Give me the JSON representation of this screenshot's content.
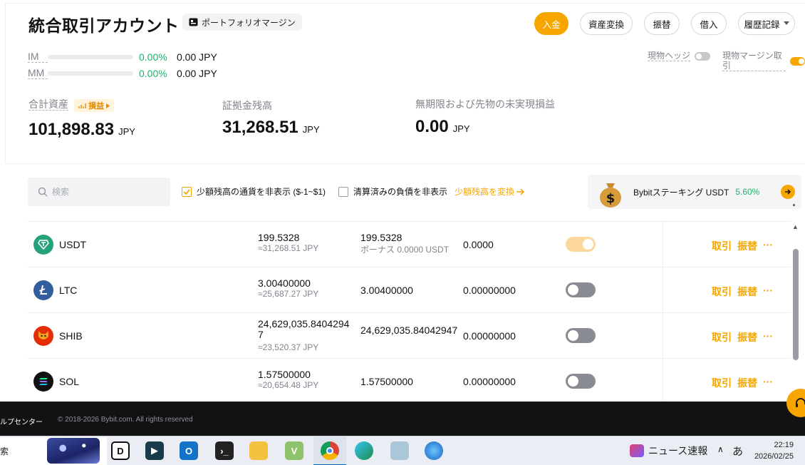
{
  "header": {
    "title": "統合取引アカウント",
    "portfolio_badge": "ポートフォリオマージン",
    "buttons": {
      "deposit": "入金",
      "convert": "資産変換",
      "transfer": "振替",
      "borrow": "借入",
      "history": "履歴記録"
    }
  },
  "margin": {
    "im": {
      "label": "IM",
      "pct": "0.00%",
      "amount": "0.00 JPY"
    },
    "mm": {
      "label": "MM",
      "pct": "0.00%",
      "amount": "0.00 JPY"
    }
  },
  "settings": {
    "spot_hedge": {
      "label": "現物ヘッジ",
      "on": false
    },
    "spot_margin": {
      "label": "現物マージン取引",
      "on": true
    }
  },
  "stats": {
    "total": {
      "label": "合計資産",
      "pl_badge": "損益",
      "value": "101,898.83",
      "unit": "JPY"
    },
    "margin_balance": {
      "label": "証拠金残高",
      "value": "31,268.51",
      "unit": "JPY"
    },
    "unrealized": {
      "label": "無期限および先物の未実現損益",
      "value": "0.00",
      "unit": "JPY"
    }
  },
  "filters": {
    "search_placeholder": "検索",
    "hide_small": {
      "label": "少額残高の通貨を非表示 ($-1~$1)",
      "checked": true
    },
    "hide_settled": {
      "label": "清算済みの負債を非表示",
      "checked": false
    },
    "convert_small": "少額残高を変換"
  },
  "staking": {
    "text": "Bybitステーキング USDT",
    "rate": "5.60%"
  },
  "assets": [
    {
      "coin": "USDT",
      "equity": "199.5328",
      "equity_jpy": "≈31,268.51 JPY",
      "wallet": "199.5328",
      "wallet_sub": "ボーナス 0.0000 USDT",
      "borrowed": "0.0000",
      "collateral": true,
      "color": "#26a17b"
    },
    {
      "coin": "LTC",
      "equity": "3.00400000",
      "equity_jpy": "≈25,687.27 JPY",
      "wallet": "3.00400000",
      "wallet_sub": "",
      "borrowed": "0.00000000",
      "collateral": false,
      "color": "#345d9d"
    },
    {
      "coin": "SHIB",
      "equity": "24,629,035.84042947",
      "equity_jpy": "≈23,520.37 JPY",
      "wallet": "24,629,035.84042947",
      "wallet_sub": "",
      "borrowed": "0.00000000",
      "collateral": false,
      "color": "#e42d04"
    },
    {
      "coin": "SOL",
      "equity": "1.57500000",
      "equity_jpy": "≈20,654.48 JPY",
      "wallet": "1.57500000",
      "wallet_sub": "",
      "borrowed": "0.00000000",
      "collateral": false,
      "color": "#111111"
    }
  ],
  "row_actions": {
    "trade": "取引",
    "transfer": "振替",
    "more": "···"
  },
  "footer": {
    "help_center": "ルプセンター",
    "copyright": "© 2018-2026 Bybit.com. All rights reserved"
  },
  "taskbar": {
    "search_text": "索",
    "news": "ニュース速報",
    "ime": "あ",
    "time": "22:19",
    "date": "2026/02/25"
  },
  "colors": {
    "accent": "#f7a600",
    "positive": "#20b26c",
    "muted": "#81858c"
  }
}
